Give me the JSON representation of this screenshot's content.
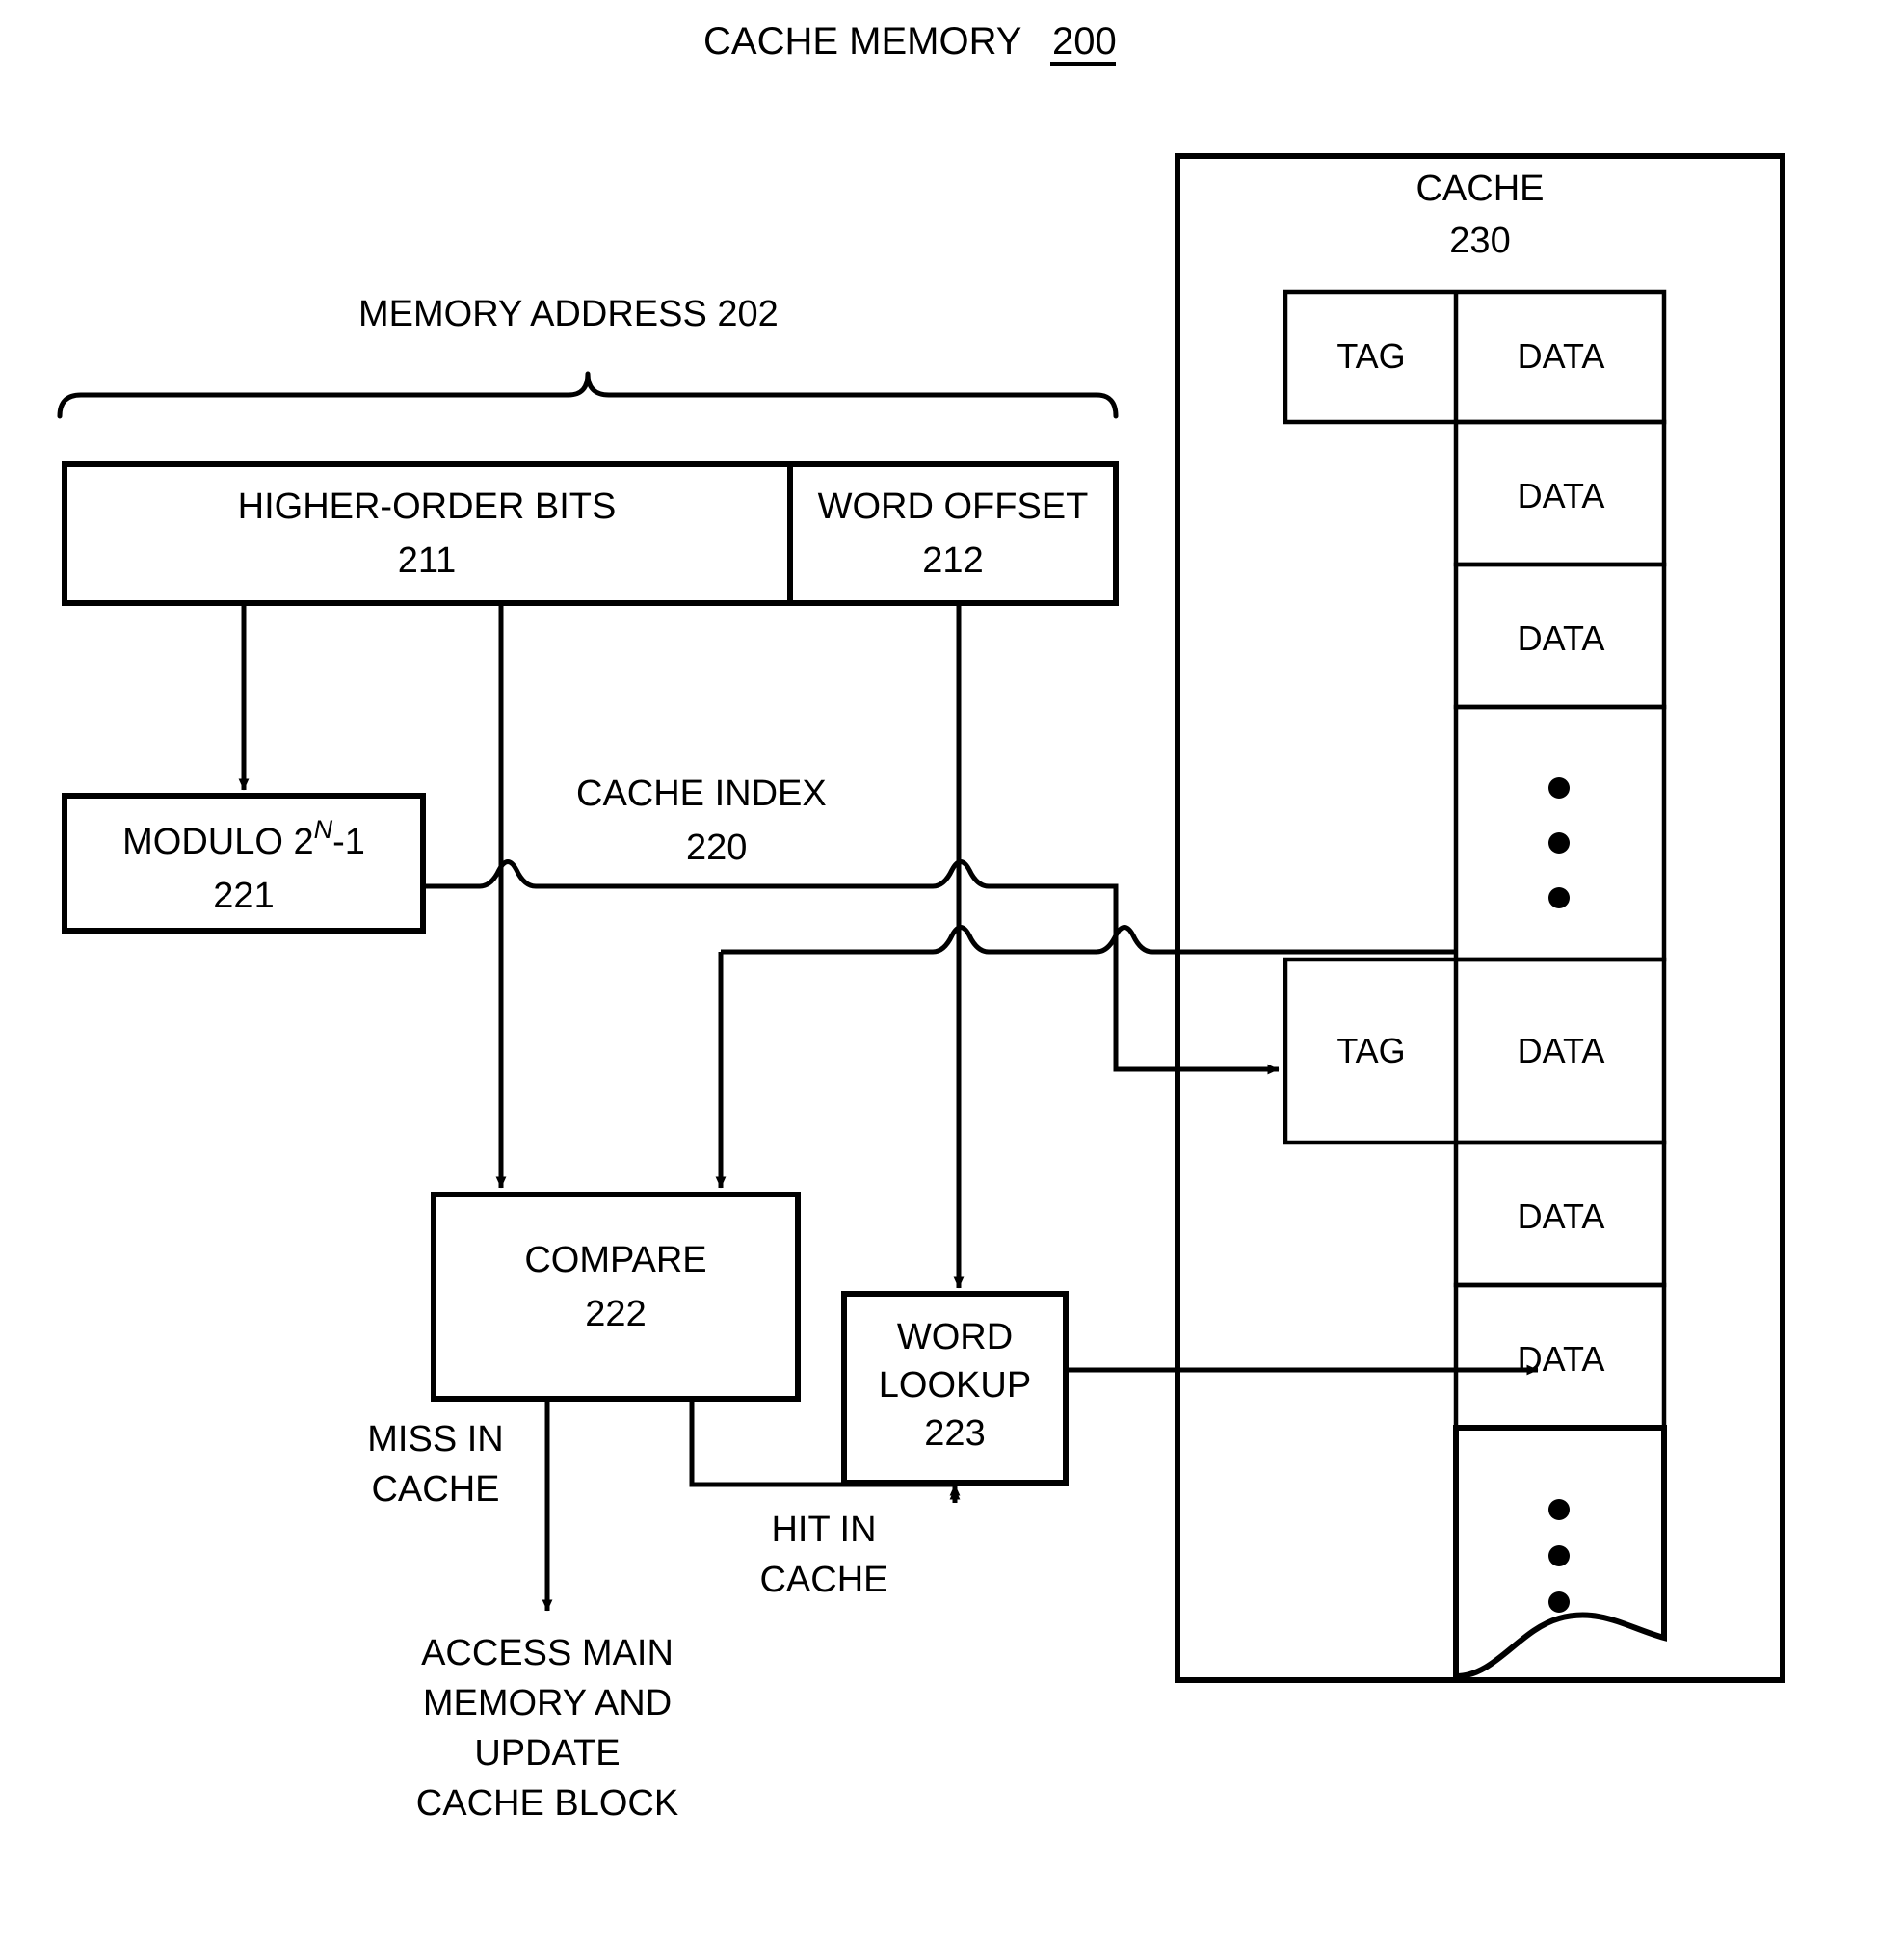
{
  "figure": {
    "title": "CACHE MEMORY",
    "title_ref": "200"
  },
  "memory_address": {
    "label": "MEMORY ADDRESS 202",
    "fields": [
      {
        "name": "HIGHER-ORDER BITS",
        "ref": "211"
      },
      {
        "name": "WORD OFFSET",
        "ref": "212"
      }
    ]
  },
  "blocks": {
    "modulo": {
      "prefix": "MODULO 2",
      "superscript": "N",
      "suffix": "-1",
      "ref": "221"
    },
    "compare": {
      "name": "COMPARE",
      "ref": "222"
    },
    "word_lookup": {
      "line1": "WORD",
      "line2": "LOOKUP",
      "ref": "223"
    }
  },
  "signals": {
    "cache_index": {
      "name": "CACHE INDEX",
      "ref": "220"
    },
    "miss": {
      "line1": "MISS IN",
      "line2": "CACHE"
    },
    "hit": {
      "line1": "HIT IN",
      "line2": "CACHE"
    }
  },
  "outcome": {
    "line1": "ACCESS MAIN",
    "line2": "MEMORY AND",
    "line3": "UPDATE",
    "line4": "CACHE BLOCK"
  },
  "cache": {
    "name": "CACHE",
    "ref": "230",
    "tag_label": "TAG",
    "data_label": "DATA",
    "rows": [
      {
        "type": "tag-data",
        "tag": "TAG",
        "data": "DATA"
      },
      {
        "type": "data",
        "data": "DATA"
      },
      {
        "type": "data",
        "data": "DATA"
      },
      {
        "type": "ellipsis"
      },
      {
        "type": "tag-data",
        "tag": "TAG",
        "data": "DATA"
      },
      {
        "type": "data",
        "data": "DATA"
      },
      {
        "type": "data",
        "data": "DATA"
      },
      {
        "type": "ellipsis-wave"
      }
    ]
  },
  "colors": {
    "ink": "#000000",
    "paper": "#ffffff"
  }
}
